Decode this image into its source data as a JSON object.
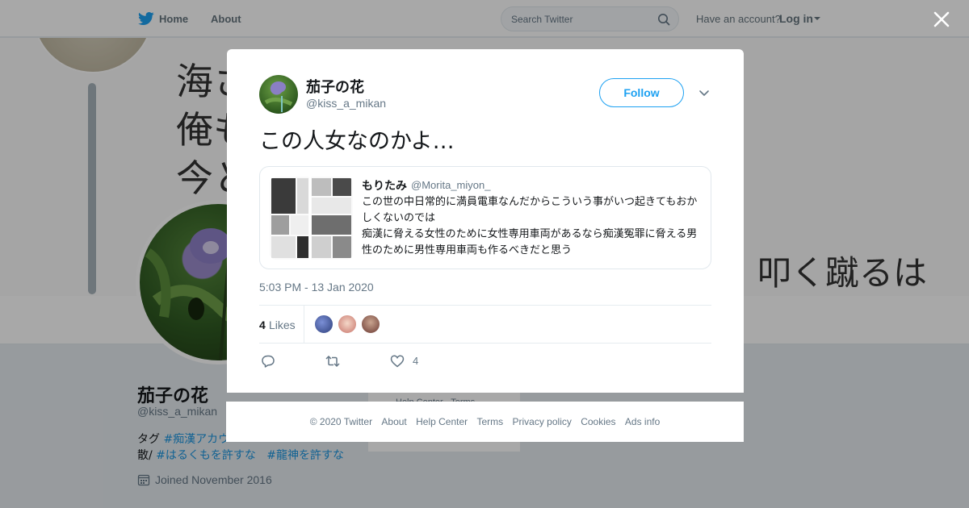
{
  "topbar": {
    "home_label": "Home",
    "about_label": "About",
    "search_placeholder": "Search Twitter",
    "have_account_label": "Have an account?",
    "login_label": "Log in"
  },
  "profile": {
    "banner_lines": [
      "海さ",
      "俺も",
      "今と"
    ],
    "banner_right_text": "叩く蹴るは",
    "name": "茄子の花",
    "handle": "@kiss_a_mikan",
    "bio_line1_prefix": "タグ ",
    "bio_line1_hashtag": "#痴漢アカウ",
    "bio_line2_prefix": "散/ ",
    "bio_line2_hashtags": [
      "#はるくもを許すな",
      "#龍神を許すな"
    ],
    "joined": "Joined November 2016",
    "side_links": "Help Center · Terms"
  },
  "tweet": {
    "author_name": "茄子の花",
    "author_handle": "@kiss_a_mikan",
    "follow_label": "Follow",
    "text": "この人女なのかよ…",
    "quote": {
      "name": "もりたみ",
      "handle": "@Morita_miyon_",
      "text": "この世の中日常的に満員電車なんだからこういう事がいつ起きてもおかしくないのでは\n痴漢に脅える女性のために女性専用車両があるなら痴漢冤罪に脅える男性のために男性専用車両も作るべきだと思う"
    },
    "timestamp": "5:03 PM - 13 Jan 2020",
    "likes_count": "4",
    "likes_label": "Likes",
    "like_action_count": "4"
  },
  "footer": {
    "links": [
      "© 2020 Twitter",
      "About",
      "Help Center",
      "Terms",
      "Privacy policy",
      "Cookies",
      "Ads info"
    ]
  },
  "icons": {
    "logo": "twitter-bird-icon",
    "search": "search-icon",
    "close": "close-icon",
    "more": "chevron-down-icon",
    "reply": "reply-icon",
    "retweet": "retweet-icon",
    "like": "heart-icon",
    "calendar": "calendar-icon"
  },
  "colors": {
    "brand": "#1da1f2",
    "link": "#1b95e0",
    "muted": "#657786",
    "text": "#14171a"
  }
}
